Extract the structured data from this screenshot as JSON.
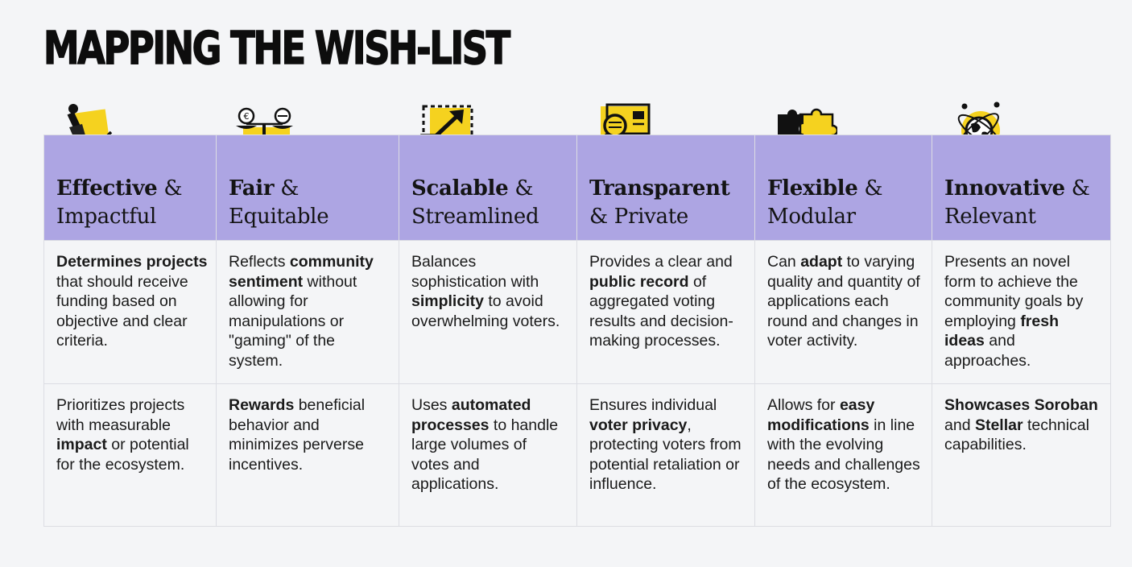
{
  "title": "MAPPING THE WISH-LIST",
  "columns": [
    {
      "icon": "stamp-checkmark-icon",
      "heading_bold": "Effective",
      "heading_rest": " & Impactful",
      "row1": [
        {
          "t": "Determines projects",
          "b": true
        },
        {
          "t": " that should receive funding based on objective and clear criteria.",
          "b": false
        }
      ],
      "row2": [
        {
          "t": "Prioritizes projects with measurable ",
          "b": false
        },
        {
          "t": "impact",
          "b": true
        },
        {
          "t": " or potential for the ecosystem.",
          "b": false
        }
      ]
    },
    {
      "icon": "balance-scale-coins-icon",
      "heading_bold": "Fair",
      "heading_rest": " & Equitable",
      "row1": [
        {
          "t": "Reflects ",
          "b": false
        },
        {
          "t": "community sentiment",
          "b": true
        },
        {
          "t": " without allowing for manipulations or \"gaming\" of the system.",
          "b": false
        }
      ],
      "row2": [
        {
          "t": "Rewards",
          "b": true
        },
        {
          "t": " beneficial behavior and minimizes perverse incentives.",
          "b": false
        }
      ]
    },
    {
      "icon": "scale-up-arrow-icon",
      "heading_bold": "Scalable",
      "heading_rest": " & Streamlined",
      "row1": [
        {
          "t": "Balances sophistication with ",
          "b": false
        },
        {
          "t": "simplicity",
          "b": true
        },
        {
          "t": " to avoid overwhelming voters.",
          "b": false
        }
      ],
      "row2": [
        {
          "t": "Uses ",
          "b": false
        },
        {
          "t": "automated processes",
          "b": true
        },
        {
          "t": " to handle large volumes of votes and applications.",
          "b": false
        }
      ]
    },
    {
      "icon": "magnifier-document-icon",
      "heading_bold": "Transparent",
      "heading_rest": " & Private",
      "row1": [
        {
          "t": "Provides a clear and ",
          "b": false
        },
        {
          "t": "public record",
          "b": true
        },
        {
          "t": " of aggregated voting results and decision-making processes.",
          "b": false
        }
      ],
      "row2": [
        {
          "t": "Ensures individual ",
          "b": false
        },
        {
          "t": "voter privacy",
          "b": true
        },
        {
          "t": ", protecting voters from potential retaliation or influence.",
          "b": false
        }
      ]
    },
    {
      "icon": "puzzle-pieces-icon",
      "heading_bold": "Flexible",
      "heading_rest": " & Modular",
      "row1": [
        {
          "t": "Can ",
          "b": false
        },
        {
          "t": "adapt",
          "b": true
        },
        {
          "t": " to varying quality and quantity of applications each round and changes in voter activity.",
          "b": false
        }
      ],
      "row2": [
        {
          "t": "Allows for ",
          "b": false
        },
        {
          "t": "easy modifications",
          "b": true
        },
        {
          "t": " in line with the evolving needs and challenges of the ecosystem.",
          "b": false
        }
      ]
    },
    {
      "icon": "atom-globe-icon",
      "heading_bold": "Innovative",
      "heading_rest": " & Relevant",
      "row1": [
        {
          "t": "Presents an novel form to achieve the community goals by employing ",
          "b": false
        },
        {
          "t": "fresh ideas",
          "b": true
        },
        {
          "t": " and approaches.",
          "b": false
        }
      ],
      "row2": [
        {
          "t": "Showcases Soroban",
          "b": true
        },
        {
          "t": " and ",
          "b": false
        },
        {
          "t": "Stellar",
          "b": true
        },
        {
          "t": " technical capabilities.",
          "b": false
        }
      ]
    }
  ],
  "colors": {
    "header_bg": "#ada5e3",
    "accent_yellow": "#f5d21f",
    "page_bg": "#f4f5f7"
  }
}
